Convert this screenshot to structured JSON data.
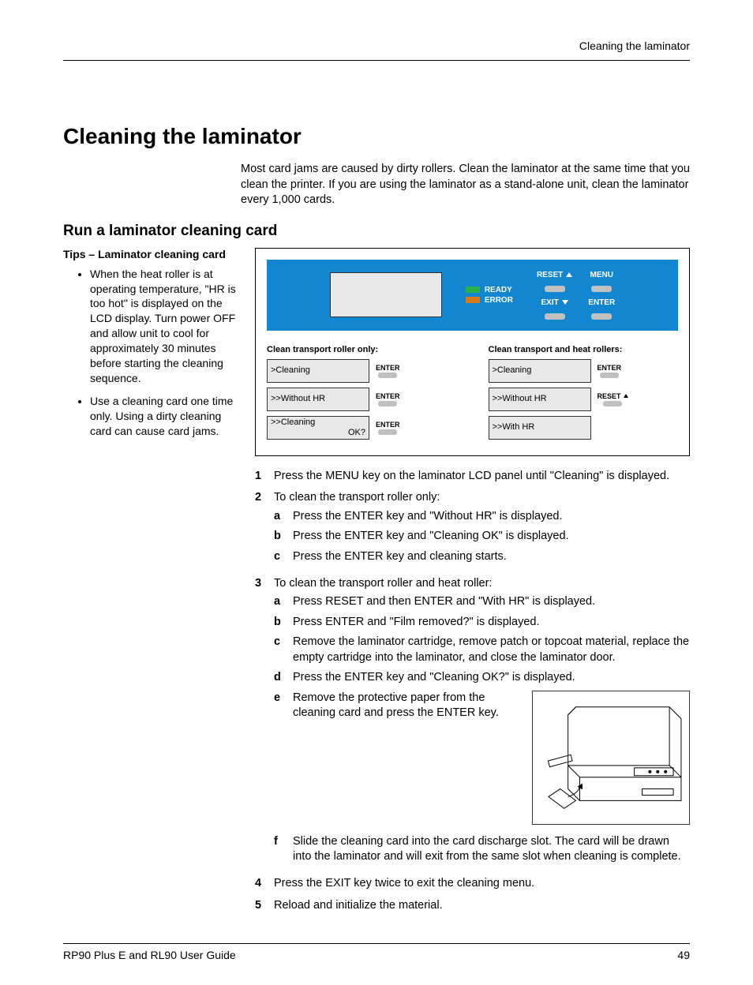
{
  "header": {
    "running_title": "Cleaning the laminator"
  },
  "title": "Cleaning the laminator",
  "intro": "Most card jams are caused by dirty rollers. Clean the laminator at the same time that you clean the printer. If you are using the laminator as a stand-alone unit, clean the laminator every 1,000 cards.",
  "section_title": "Run a laminator cleaning card",
  "sidebar": {
    "title": "Tips – Laminator cleaning card",
    "bullets": [
      "When the heat roller is at operating temperature, \"HR is too hot\" is displayed on the LCD display. Turn power OFF and allow unit to cool for approximately 30 minutes before starting the cleaning sequence.",
      "Use a cleaning card one time only. Using a dirty cleaning card can cause card jams."
    ]
  },
  "panel": {
    "ready": "READY",
    "error": "ERROR",
    "reset": "RESET",
    "exit": "EXIT",
    "menu": "MENU",
    "enter": "ENTER"
  },
  "seq": {
    "left_title": "Clean transport roller only:",
    "right_title": "Clean transport and heat rollers:",
    "enter_lbl": "ENTER",
    "reset_lbl": "RESET",
    "l1a": ">Cleaning",
    "l2a": ">>Without HR",
    "l3a": ">>Cleaning",
    "l3b": "OK?",
    "r1a": ">Cleaning",
    "r2a": ">>Without HR",
    "r3a": ">>With HR"
  },
  "steps": {
    "s1": "Press the MENU key on the laminator LCD panel until \"Cleaning\" is displayed.",
    "s2": "To clean the transport roller only:",
    "s2a": "Press the ENTER key and \"Without HR\" is displayed.",
    "s2b": "Press the ENTER key and \"Cleaning OK\" is displayed.",
    "s2c": "Press the ENTER key and cleaning starts.",
    "s3": "To clean the transport roller and heat roller:",
    "s3a": "Press RESET and then ENTER and \"With HR\" is displayed.",
    "s3b": "Press ENTER and \"Film removed?\" is displayed.",
    "s3c": "Remove the laminator cartridge, remove patch or topcoat material, replace the empty cartridge into the laminator, and close the laminator door.",
    "s3d": "Press the ENTER key and \"Cleaning OK?\" is displayed.",
    "s3e": "Remove the protective paper from the cleaning card and press the ENTER key.",
    "s3f": "Slide the cleaning card into the card discharge slot. The card will be drawn into the laminator and will exit from the same slot when cleaning is complete.",
    "s4": "Press the EXIT key twice to exit the cleaning menu.",
    "s5": "Reload and initialize the material."
  },
  "footer": {
    "doc": "RP90 Plus E and RL90 User Guide",
    "page": "49"
  }
}
